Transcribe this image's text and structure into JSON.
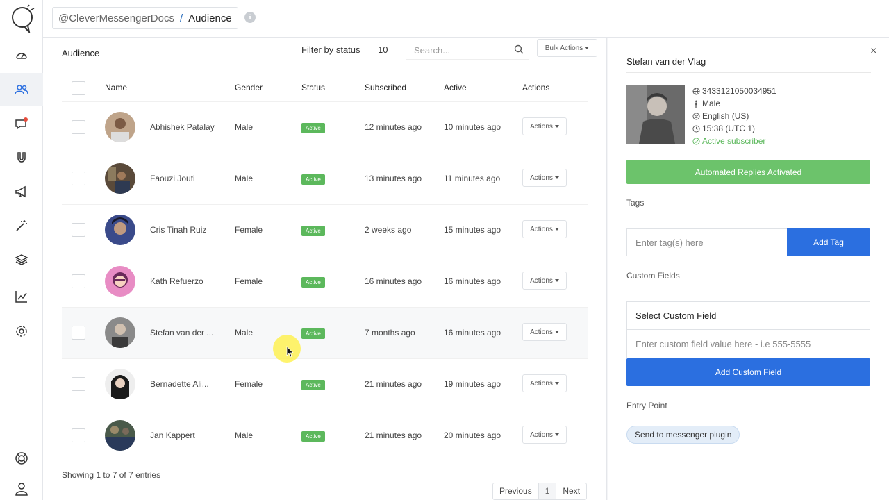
{
  "colors": {
    "accent_blue": "#2b6fe0",
    "active_green": "#5cb85c",
    "auto_green": "#6cc36b"
  },
  "sidebar": {
    "items": [
      {
        "icon": "dashboard-icon"
      },
      {
        "icon": "users-icon",
        "active": true
      },
      {
        "icon": "chat-icon"
      },
      {
        "icon": "magnet-icon"
      },
      {
        "icon": "megaphone-icon"
      },
      {
        "icon": "magic-wand-icon"
      },
      {
        "icon": "layers-icon"
      },
      {
        "icon": "analytics-icon"
      },
      {
        "icon": "gear-icon"
      }
    ],
    "bottom": [
      {
        "icon": "help-icon"
      },
      {
        "icon": "profile-icon"
      }
    ]
  },
  "topbar": {
    "account": "@CleverMessengerDocs",
    "separator": "/",
    "page": "Audience",
    "info": "i"
  },
  "main": {
    "title": "Audience",
    "filter_label": "Filter by status",
    "page_size": "10",
    "search_placeholder": "Search...",
    "bulk_actions": "Bulk Actions",
    "columns": {
      "name": "Name",
      "gender": "Gender",
      "status": "Status",
      "subscribed": "Subscribed",
      "active": "Active",
      "actions": "Actions"
    },
    "rows": [
      {
        "name": "Abhishek Patalay",
        "gender": "Male",
        "status": "Active",
        "subscribed": "12 minutes ago",
        "active": "10 minutes ago",
        "actions": "Actions"
      },
      {
        "name": "Faouzi Jouti",
        "gender": "Male",
        "status": "Active",
        "subscribed": "13 minutes ago",
        "active": "11 minutes ago",
        "actions": "Actions"
      },
      {
        "name": "Cris Tinah Ruiz",
        "gender": "Female",
        "status": "Active",
        "subscribed": "2 weeks ago",
        "active": "15 minutes ago",
        "actions": "Actions"
      },
      {
        "name": "Kath Refuerzo",
        "gender": "Female",
        "status": "Active",
        "subscribed": "16 minutes ago",
        "active": "16 minutes ago",
        "actions": "Actions"
      },
      {
        "name": "Stefan van der ...",
        "gender": "Male",
        "status": "Active",
        "subscribed": "7 months ago",
        "active": "16 minutes ago",
        "actions": "Actions"
      },
      {
        "name": "Bernadette Ali...",
        "gender": "Female",
        "status": "Active",
        "subscribed": "21 minutes ago",
        "active": "19 minutes ago",
        "actions": "Actions"
      },
      {
        "name": "Jan Kappert",
        "gender": "Male",
        "status": "Active",
        "subscribed": "21 minutes ago",
        "active": "20 minutes ago",
        "actions": "Actions"
      }
    ],
    "showing": "Showing 1 to 7 of 7 entries",
    "pagination": {
      "previous": "Previous",
      "current": "1",
      "next": "Next"
    }
  },
  "detail": {
    "close": "×",
    "name": "Stefan van der Vlag",
    "id": "3433121050034951",
    "gender": "Male",
    "locale": "English (US)",
    "time": "15:38 (UTC 1)",
    "status": "Active subscriber",
    "automated_replies": "Automated Replies Activated",
    "tags_label": "Tags",
    "tag_placeholder": "Enter tag(s) here",
    "add_tag": "Add Tag",
    "custom_fields_label": "Custom Fields",
    "custom_field_select": "Select Custom Field",
    "custom_field_placeholder": "Enter custom field value here - i.e 555-5555",
    "add_custom_field": "Add Custom Field",
    "entry_point_label": "Entry Point",
    "entry_point": "Send to messenger plugin"
  }
}
